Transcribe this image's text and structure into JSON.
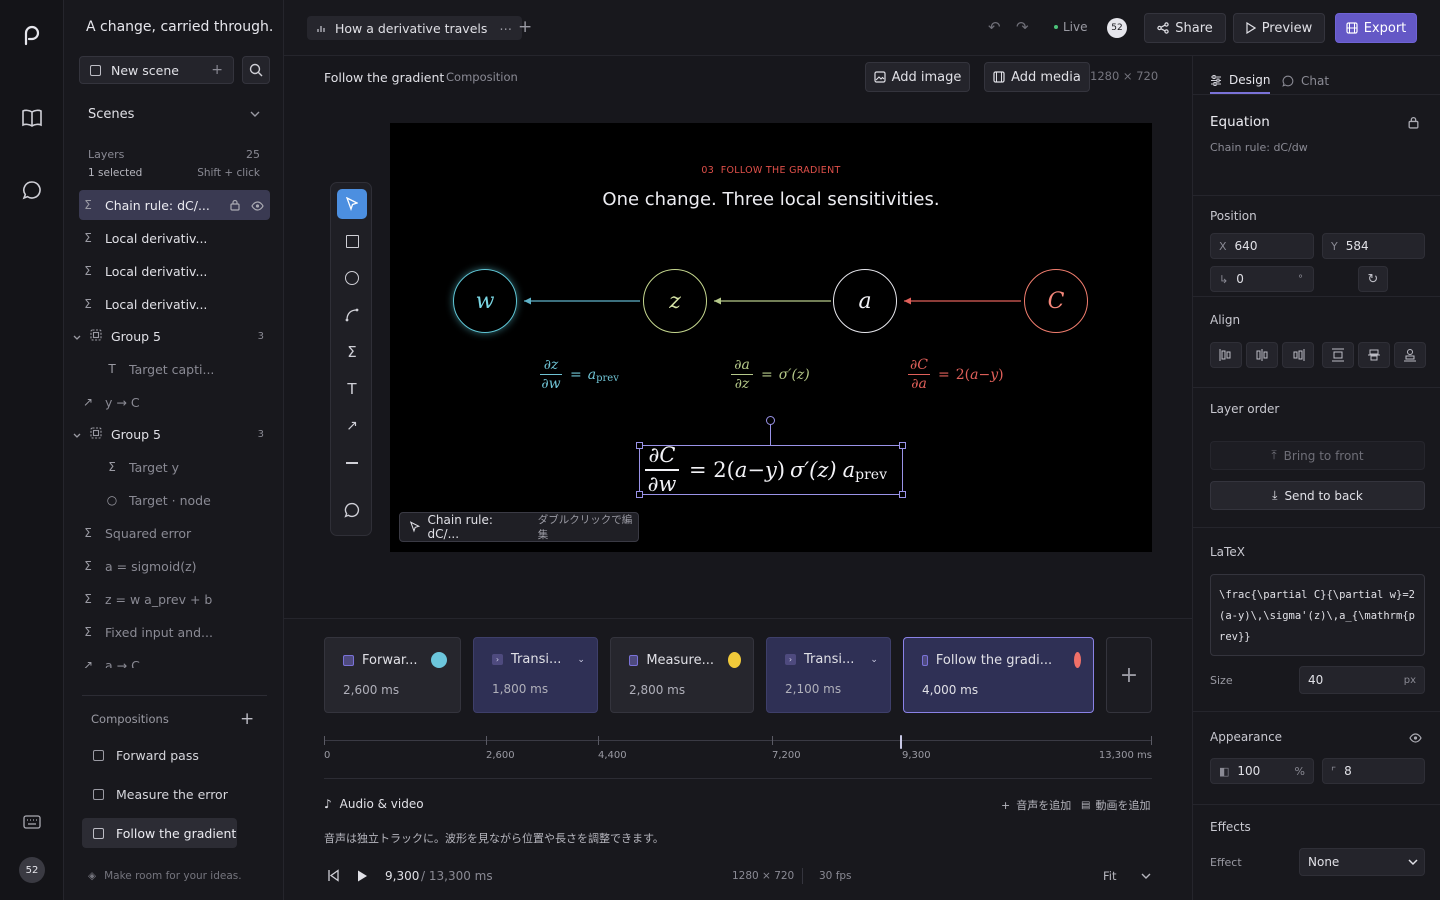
{
  "rail": {
    "avatar": "52"
  },
  "sidebar": {
    "project_title": "A change, carried through.",
    "new_scene_label": "New scene",
    "scenes_label": "Scenes",
    "layers_label": "Layers",
    "layers_count": "25",
    "selected_text": "1 selected",
    "shift_hint": "Shift + click",
    "layers": [
      {
        "label": "Chain rule: dC/...",
        "icon": "sigma-icon"
      },
      {
        "label": "Local derivativ...",
        "icon": "sigma-icon"
      },
      {
        "label": "Local derivativ...",
        "icon": "sigma-icon"
      },
      {
        "label": "Local derivativ...",
        "icon": "sigma-icon"
      },
      {
        "label": "Group 5",
        "count": "3",
        "icon": "group-icon"
      },
      {
        "label": "Target capti...",
        "icon": "text-icon"
      },
      {
        "label": "y → C",
        "icon": "arrow-icon"
      },
      {
        "label": "Group 5",
        "count": "3",
        "icon": "group-icon"
      },
      {
        "label": "Target y",
        "icon": "sigma-icon"
      },
      {
        "label": "Target · node",
        "icon": "circle-icon"
      },
      {
        "label": "Squared error",
        "icon": "sigma-icon"
      },
      {
        "label": "a = sigmoid(z)",
        "icon": "sigma-icon"
      },
      {
        "label": "z = w a_prev + b",
        "icon": "sigma-icon"
      },
      {
        "label": "Fixed input and...",
        "icon": "sigma-icon"
      },
      {
        "label": "a → C",
        "icon": "arrow-icon"
      }
    ],
    "compositions_label": "Compositions",
    "compositions": [
      "Forward pass",
      "Measure the error",
      "Follow the gradient"
    ],
    "footer_hint": "Make room for your ideas."
  },
  "topbar": {
    "tab_label": "How a derivative travels",
    "live_label": "Live",
    "user_badge": "52",
    "share_label": "Share",
    "preview_label": "Preview",
    "export_label": "Export"
  },
  "canvas": {
    "scene_title": "Follow the gradient",
    "scene_type": "Composition",
    "add_image_label": "Add image",
    "add_media_label": "Add media",
    "dimensions": "1280 × 720",
    "eyebrow": "03  FOLLOW THE GRADIENT",
    "headline": "One change. Three local sensitivities.",
    "nodes": [
      "w",
      "z",
      "a",
      "C"
    ],
    "selection_label": "Chain rule: dC/...",
    "selection_hint": "ダブルクリックで編集"
  },
  "timeline": {
    "cards": [
      {
        "label": "Forwar...",
        "duration": "2,600 ms"
      },
      {
        "label": "Transi...",
        "duration": "1,800 ms"
      },
      {
        "label": "Measure...",
        "duration": "2,800 ms"
      },
      {
        "label": "Transi...",
        "duration": "2,100 ms"
      },
      {
        "label": "Follow the gradi...",
        "duration": "4,000 ms"
      }
    ],
    "ticks": [
      "0",
      "2,600",
      "4,400",
      "7,200",
      "9,300",
      "13,300 ms"
    ],
    "audio_label": "Audio & video",
    "add_audio_label": "音声を追加",
    "add_video_label": "動画を追加",
    "audio_hint": "音声は独立トラックに。波形を見ながら位置や長さを調整できます。",
    "current_time": "9,300",
    "total_time": "/ 13,300 ms",
    "resolution": "1280 × 720",
    "fps": "30 fps",
    "fit_label": "Fit"
  },
  "panel": {
    "tab_design": "Design",
    "tab_chat": "Chat",
    "object_type": "Equation",
    "object_name": "Chain rule: dC/dw",
    "position_label": "Position",
    "x_label": "X",
    "x_value": "640",
    "y_label": "Y",
    "y_value": "584",
    "rotation_value": "0",
    "rotation_unit": "°",
    "align_label": "Align",
    "layer_order_label": "Layer order",
    "bring_front_label": "Bring to front",
    "send_back_label": "Send to back",
    "latex_label": "LaTeX",
    "latex_value": "\\frac{\\partial C}{\\partial w}=2(a-y)\\,\\sigma'(z)\\,a_{\\mathrm{prev}}",
    "size_label": "Size",
    "size_value": "40",
    "size_unit": "px",
    "appearance_label": "Appearance",
    "opacity_value": "100",
    "opacity_unit": "%",
    "radius_value": "8",
    "effects_label": "Effects",
    "effect_label": "Effect",
    "effect_value": "None"
  }
}
